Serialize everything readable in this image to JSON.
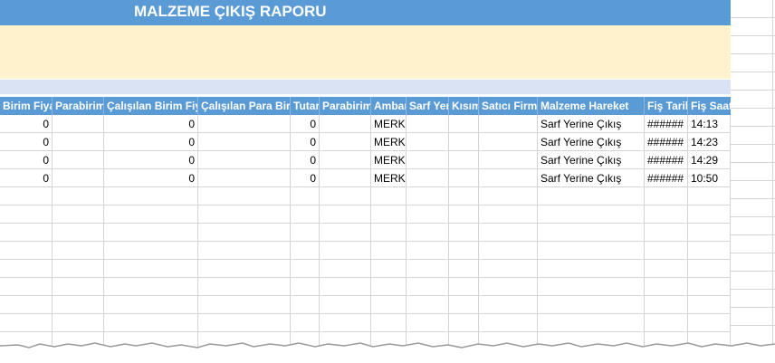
{
  "report": {
    "title": "MALZEME ÇIKIŞ RAPORU"
  },
  "columns": [
    "Birim Fiyat",
    "Parabirimi",
    "Çalışılan Birim Fiyat",
    "Çalışılan Para Birimi",
    "Tutar",
    "Parabirimi",
    "Ambar",
    "Sarf Yeri",
    "Kısım",
    "Satıcı Firma",
    "Malzeme Hareket",
    "Fiş Tarihi",
    "Fiş Saati"
  ],
  "rows": [
    {
      "birim_fiyat": "0",
      "calisilan_birim_fiyat": "0",
      "tutar": "0",
      "ambar": "MERK",
      "hareket": "Sarf Yerine Çıkış",
      "fis_tarihi": "######",
      "fis_saati": "14:13"
    },
    {
      "birim_fiyat": "0",
      "calisilan_birim_fiyat": "0",
      "tutar": "0",
      "ambar": "MERK",
      "hareket": "Sarf Yerine Çıkış",
      "fis_tarihi": "######",
      "fis_saati": "14:23"
    },
    {
      "birim_fiyat": "0",
      "calisilan_birim_fiyat": "0",
      "tutar": "0",
      "ambar": "MERK",
      "hareket": "Sarf Yerine Çıkış",
      "fis_tarihi": "######",
      "fis_saati": "14:29"
    },
    {
      "birim_fiyat": "0",
      "calisilan_birim_fiyat": "0",
      "tutar": "0",
      "ambar": "MERK",
      "hareket": "Sarf Yerine Çıkış",
      "fis_tarihi": "######",
      "fis_saati": "10:50"
    }
  ],
  "colors": {
    "title_band": "#5b9bd5",
    "note_band": "#fff2cc",
    "sub_band": "#dae3f3",
    "header_text": "#ffffff",
    "gridline": "#d4d4d4"
  }
}
